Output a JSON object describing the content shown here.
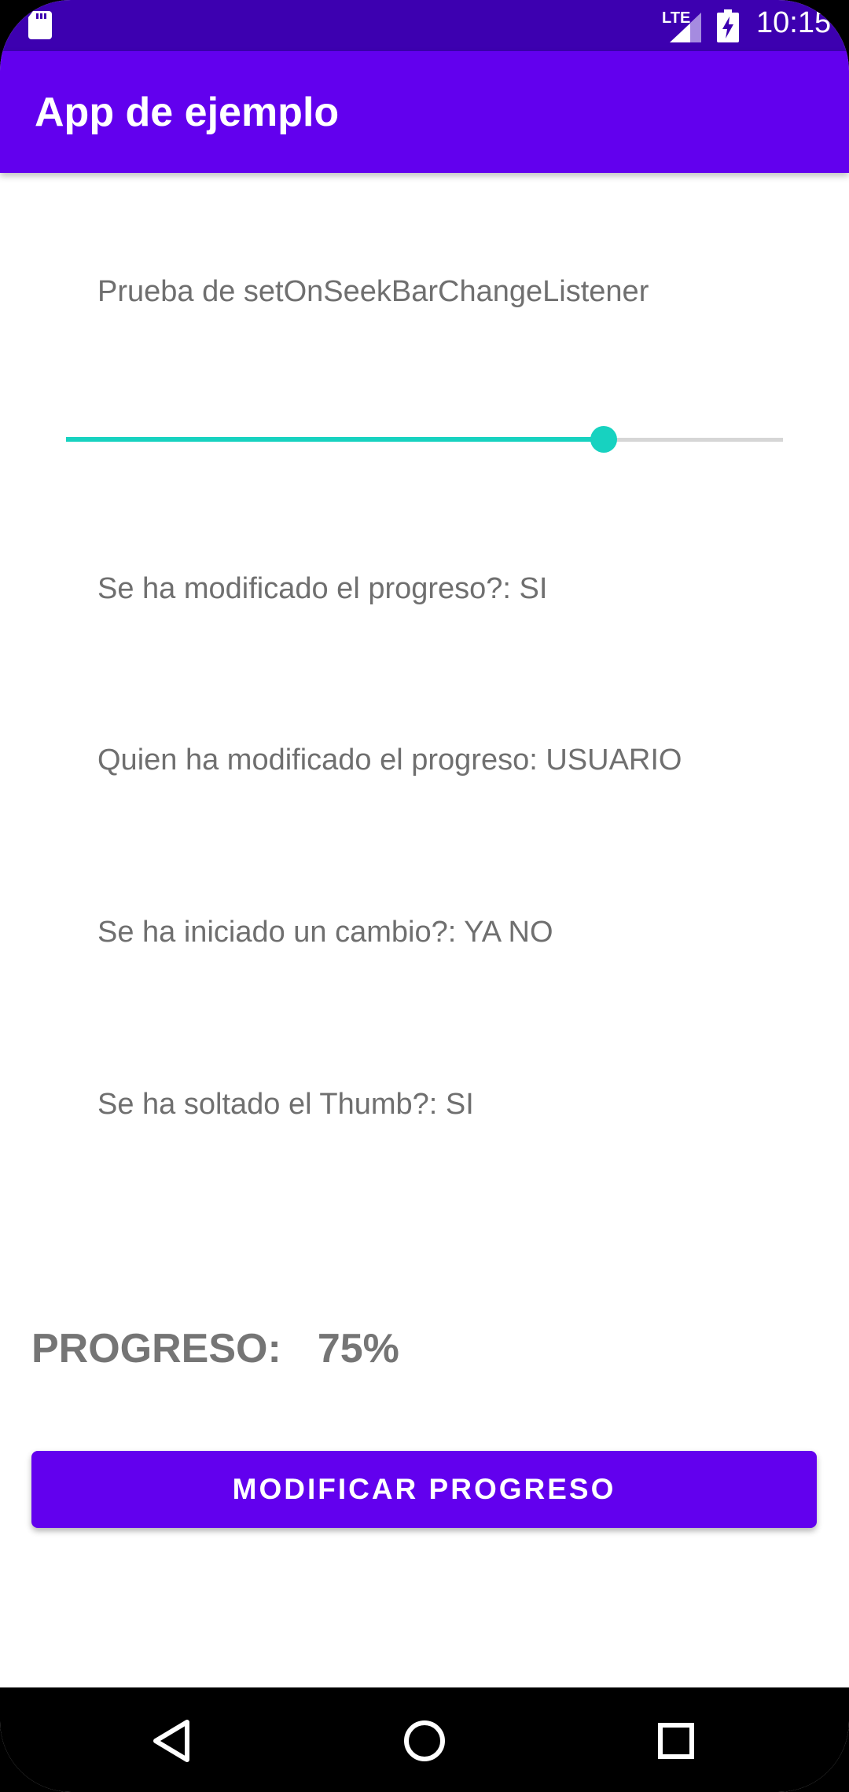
{
  "status_bar": {
    "network": "LTE",
    "time": "10:15",
    "icons": [
      "sd-card-icon",
      "signal-icon",
      "battery-charging-icon"
    ],
    "background": "#3d00b0"
  },
  "app_bar": {
    "title": "App de ejemplo",
    "background": "#6200ee"
  },
  "main": {
    "heading": "Prueba de setOnSeekBarChangeListener",
    "seekbar": {
      "progress_percent": 75,
      "accent_color": "#17d2c0"
    },
    "status_lines": [
      "Se ha modificado el progreso?: SI",
      "Quien ha modificado el progreso: USUARIO",
      "Se ha iniciado un cambio?: YA NO",
      "Se ha soltado el Thumb?: SI"
    ],
    "progress_label": "PROGRESO:",
    "progress_value": "75%",
    "button_label": "MODIFICAR PROGRESO"
  },
  "nav_bar": {
    "buttons": [
      "back-icon",
      "home-icon",
      "recents-icon"
    ]
  }
}
